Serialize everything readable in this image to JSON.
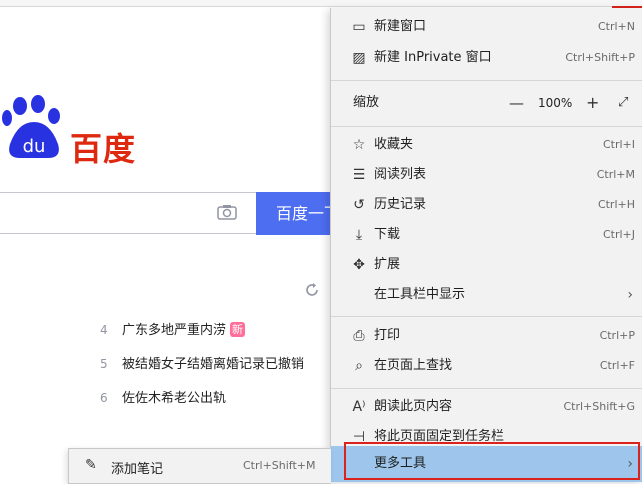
{
  "colors": {
    "baidu_red": "#de2910",
    "baidu_blue": "#2932e1",
    "search_button": "#4e6ef2",
    "highlight": "#9ec6ec",
    "red_box": "#d9231c"
  },
  "baidu": {
    "logo_text": "百度",
    "logo_du": "du",
    "search_button_label": "百度一下",
    "hot_items": [
      {
        "num": "4",
        "text": "广东多地严重内涝",
        "badge": "新"
      },
      {
        "num": "5",
        "text": "被结婚女子结婚离婚记录已撤销",
        "badge": ""
      },
      {
        "num": "6",
        "text": "佐佐木希老公出轨",
        "badge": ""
      }
    ]
  },
  "menu": {
    "new_window": {
      "icon": "window-icon",
      "label": "新建窗口",
      "shortcut": "Ctrl+N"
    },
    "new_inprivate": {
      "icon": "inprivate-icon",
      "label": "新建 InPrivate 窗口",
      "shortcut": "Ctrl+Shift+P"
    },
    "zoom": {
      "label": "缩放",
      "value": "100%"
    },
    "favorites": {
      "icon": "favorites-icon",
      "label": "收藏夹",
      "shortcut": "Ctrl+I"
    },
    "reading_list": {
      "icon": "reading-list-icon",
      "label": "阅读列表",
      "shortcut": "Ctrl+M"
    },
    "history": {
      "icon": "history-icon",
      "label": "历史记录",
      "shortcut": "Ctrl+H"
    },
    "downloads": {
      "icon": "download-icon",
      "label": "下载",
      "shortcut": "Ctrl+J"
    },
    "extensions": {
      "icon": "extensions-icon",
      "label": "扩展",
      "shortcut": ""
    },
    "show_in_toolbar": {
      "label": "在工具栏中显示"
    },
    "print": {
      "icon": "print-icon",
      "label": "打印",
      "shortcut": "Ctrl+P"
    },
    "find": {
      "icon": "search-icon",
      "label": "在页面上查找",
      "shortcut": "Ctrl+F"
    },
    "read_aloud": {
      "icon": "read-aloud-icon",
      "label": "朗读此页内容",
      "shortcut": "Ctrl+Shift+G"
    },
    "pin_taskbar": {
      "icon": "pin-icon",
      "label": "将此页面固定到任务栏"
    },
    "more_tools": {
      "label": "更多工具"
    }
  },
  "submenu": {
    "add_notes": {
      "icon": "pen-icon",
      "label": "添加笔记",
      "shortcut": "Ctrl+Shift+M"
    }
  }
}
